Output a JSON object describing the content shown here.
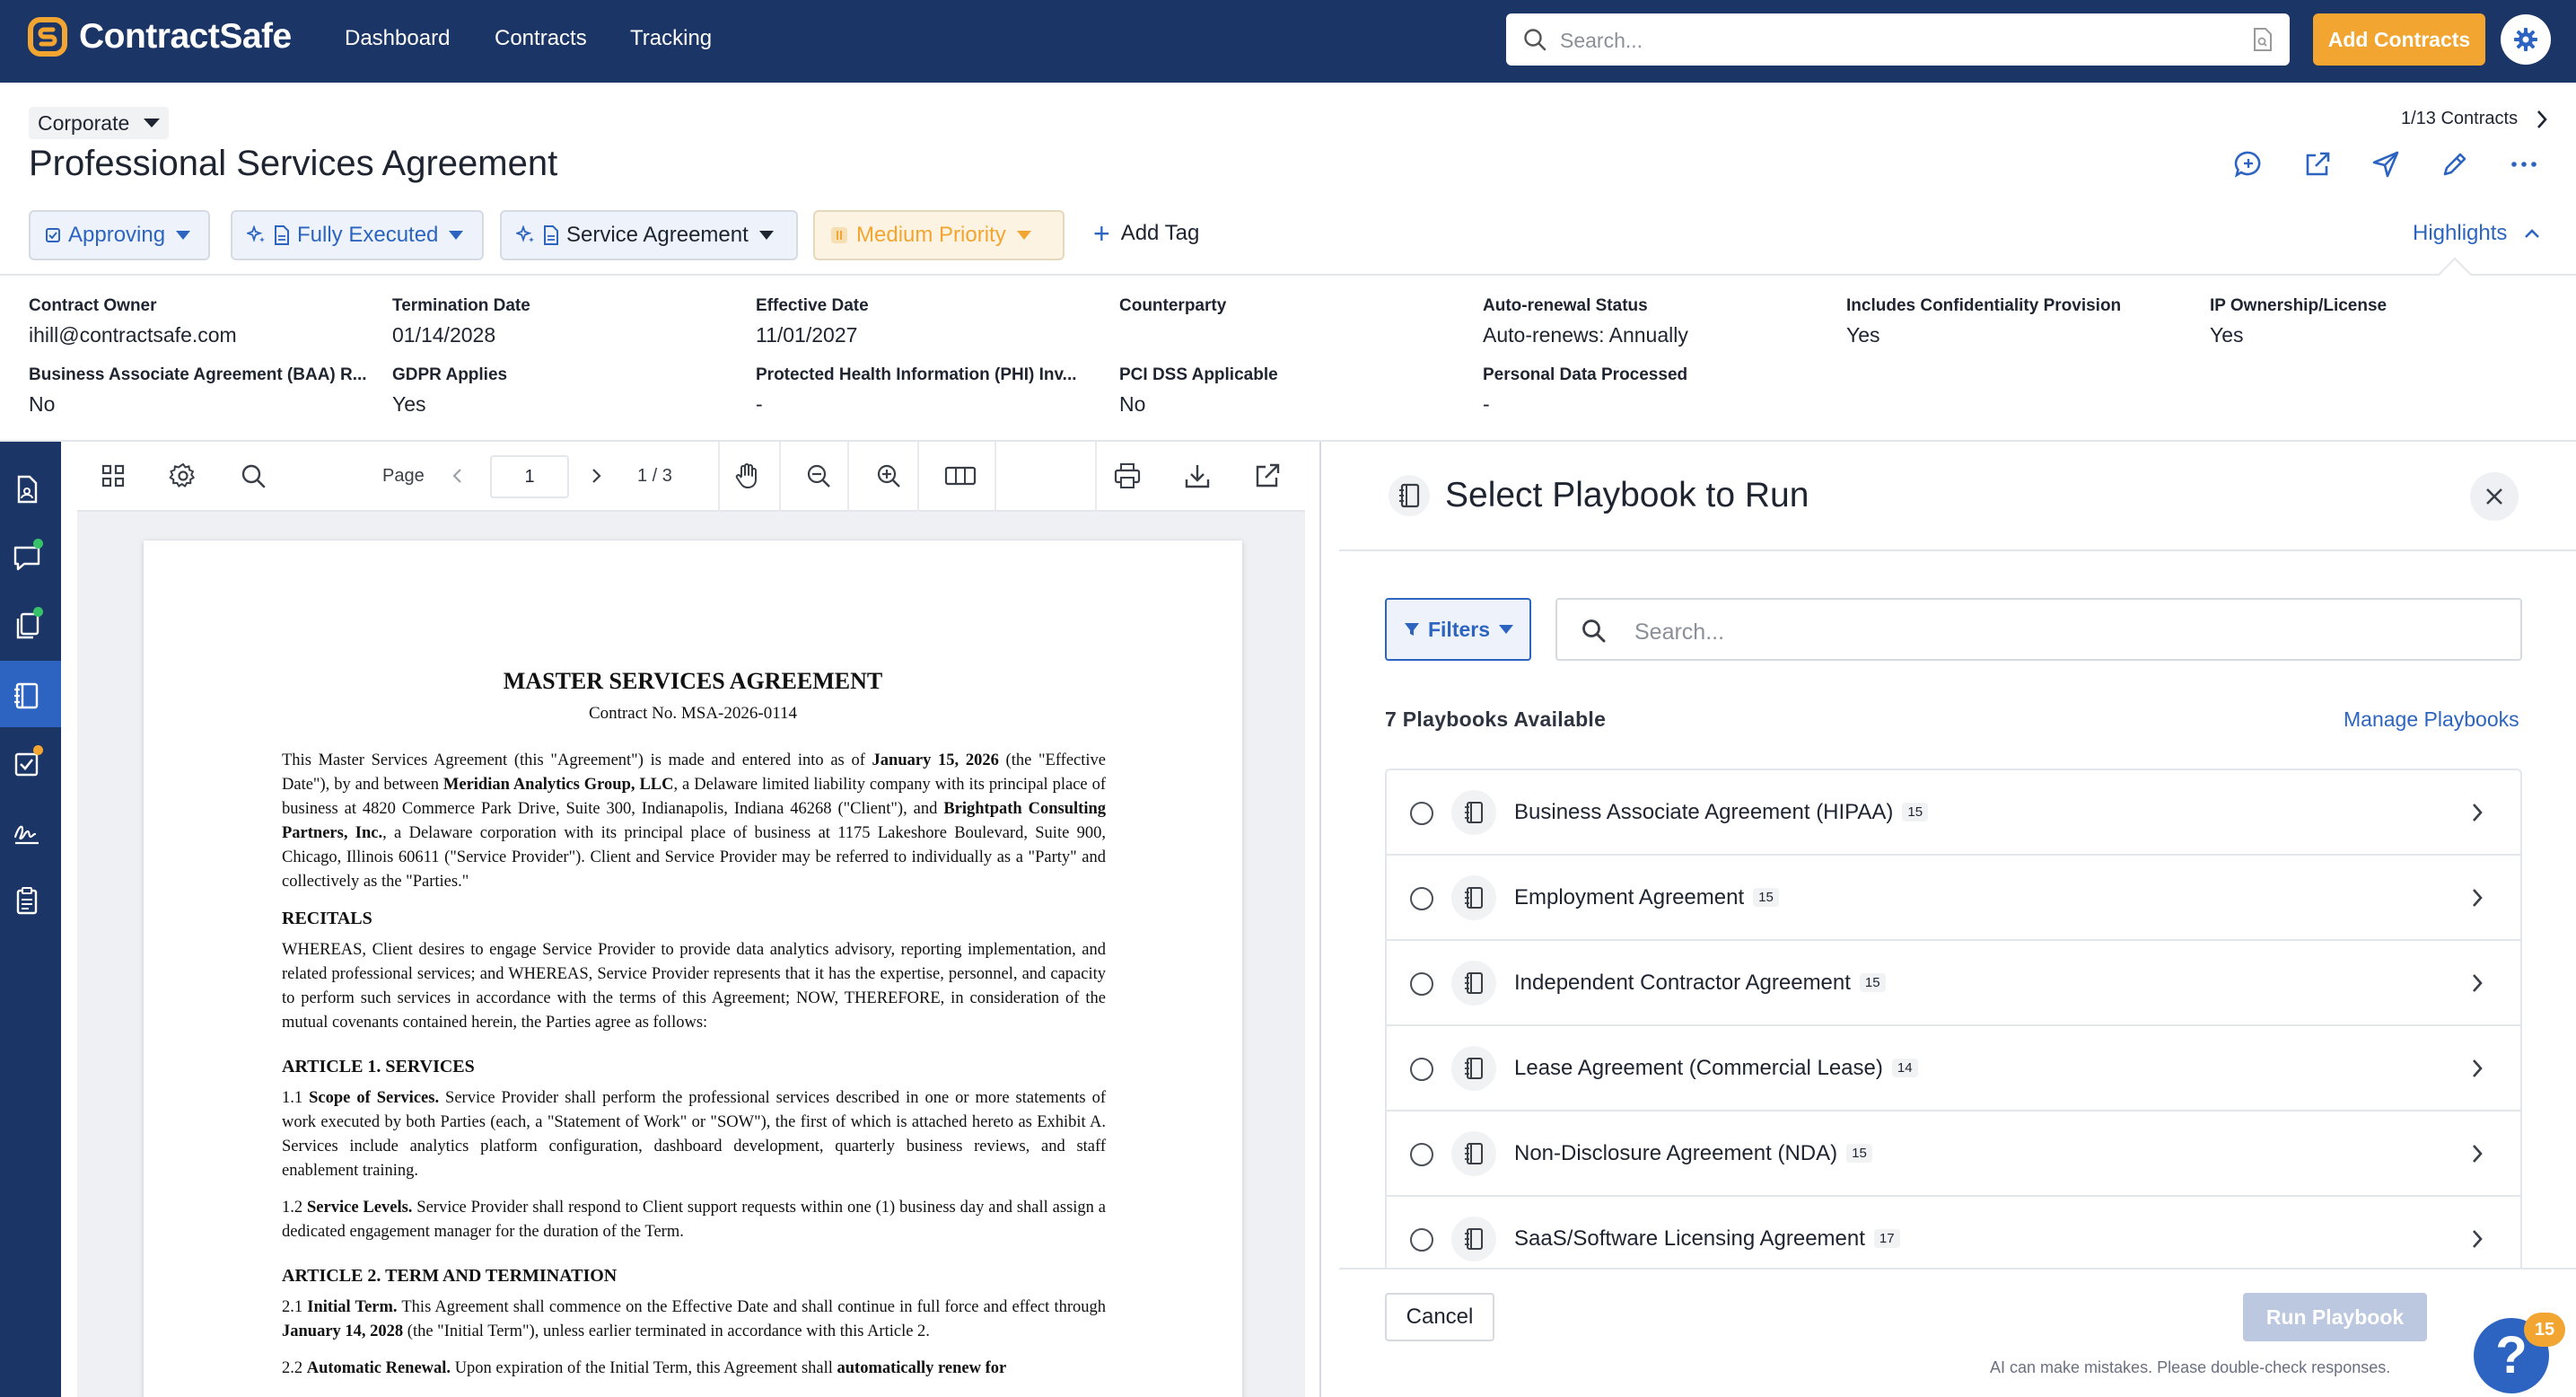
{
  "app": {
    "brand": "ContractSafe",
    "nav": [
      "Dashboard",
      "Contracts",
      "Tracking"
    ],
    "search_placeholder": "Search...",
    "add_contracts": "Add Contracts",
    "colors": {
      "navy": "#1b3566",
      "accent": "#f2a530",
      "link": "#2c64c0"
    }
  },
  "header": {
    "folder": "Corporate",
    "title": "Professional Services Agreement",
    "contract_count": "1/13 Contracts",
    "actions": [
      "comment-icon",
      "external-link-icon",
      "send-icon",
      "edit-icon",
      "more-icon"
    ]
  },
  "pills": {
    "status": "Approving",
    "execution": "Fully Executed",
    "type": "Service Agreement",
    "priority": "Medium Priority",
    "add_tag": "Add Tag",
    "highlights": "Highlights"
  },
  "metadata": [
    {
      "label": "Contract Owner",
      "value": "ihill@contractsafe.com"
    },
    {
      "label": "Termination Date",
      "value": "01/14/2028"
    },
    {
      "label": "Effective Date",
      "value": "11/01/2027"
    },
    {
      "label": "Counterparty",
      "value": ""
    },
    {
      "label": "Auto-renewal Status",
      "value": "Auto-renews: Annually"
    },
    {
      "label": "Includes Confidentiality Provision",
      "value": "Yes"
    },
    {
      "label": "IP Ownership/License",
      "value": "Yes"
    },
    {
      "label": "Business Associate Agreement (BAA) R...",
      "value": "No"
    },
    {
      "label": "GDPR Applies",
      "value": "Yes"
    },
    {
      "label": "Protected Health Information (PHI) Inv...",
      "value": "-"
    },
    {
      "label": "PCI DSS Applicable",
      "value": "No"
    },
    {
      "label": "Personal Data Processed",
      "value": "-"
    }
  ],
  "viewer": {
    "page_label": "Page",
    "page_value": "1",
    "page_total": "1 / 3"
  },
  "document": {
    "title": "MASTER SERVICES AGREEMENT",
    "subtitle": "Contract No. MSA-2026-0114",
    "intro_1": "This Master Services Agreement (this \"Agreement\") is made and entered into as of ",
    "intro_date": "January 15, 2026",
    "intro_2": " (the \"Effective Date\"), by and between ",
    "party_1": "Meridian Analytics Group, LLC",
    "intro_3": ", a Delaware limited liability company with its principal place of business at 4820 Commerce Park Drive, Suite 300, Indianapolis, Indiana 46268 (\"Client\"), and ",
    "party_2": "Brightpath Consulting Partners, Inc.",
    "intro_4": ", a Delaware corporation with its principal place of business at 1175 Lakeshore Boulevard, Suite 900, Chicago, Illinois 60611 (\"Service Provider\"). Client and Service Provider may be referred to individually as a \"Party\" and collectively as the \"Parties.\"",
    "recitals_h": "RECITALS",
    "recitals": "WHEREAS, Client desires to engage Service Provider to provide data analytics advisory, reporting implementation, and related professional services; and WHEREAS, Service Provider represents that it has the expertise, personnel, and capacity to perform such services in accordance with the terms of this Agreement; NOW, THEREFORE, in consideration of the mutual covenants contained herein, the Parties agree as follows:",
    "art1_h": "ARTICLE 1. SERVICES",
    "s11_num": "1.1 ",
    "s11_title": "Scope of Services.",
    "s11_text": " Service Provider shall perform the professional services described in one or more statements of work executed by both Parties (each, a \"Statement of Work\" or \"SOW\"), the first of which is attached hereto as Exhibit A. Services include analytics platform configuration, dashboard development, quarterly business reviews, and staff enablement training.",
    "s12_num": "1.2 ",
    "s12_title": "Service Levels.",
    "s12_text": " Service Provider shall respond to Client support requests within one (1) business day and shall assign a dedicated engagement manager for the duration of the Term.",
    "art2_h": "ARTICLE 2. TERM AND TERMINATION",
    "s21_num": "2.1 ",
    "s21_title": "Initial Term.",
    "s21_text_1": " This Agreement shall commence on the Effective Date and shall continue in full force and effect through ",
    "s21_date": "January 14, 2028",
    "s21_text_2": " (the \"Initial Term\"), unless earlier terminated in accordance with this Article 2.",
    "s22_num": "2.2 ",
    "s22_title": "Automatic Renewal.",
    "s22_text_1": " Upon expiration of the Initial Term, this Agreement shall ",
    "s22_bold": "automatically renew for"
  },
  "playbook_panel": {
    "title": "Select Playbook to Run",
    "filters": "Filters",
    "search_placeholder": "Search...",
    "count_label": "7 Playbooks Available",
    "manage_link": "Manage Playbooks",
    "items": [
      {
        "name": "Business Associate Agreement (HIPAA)",
        "count": "15"
      },
      {
        "name": "Employment Agreement",
        "count": "15"
      },
      {
        "name": "Independent Contractor Agreement",
        "count": "15"
      },
      {
        "name": "Lease Agreement (Commercial Lease)",
        "count": "14"
      },
      {
        "name": "Non-Disclosure Agreement (NDA)",
        "count": "15"
      },
      {
        "name": "SaaS/Software Licensing Agreement",
        "count": "17"
      }
    ],
    "cancel": "Cancel",
    "run": "Run Playbook",
    "disclaimer": "AI can make mistakes. Please double-check responses."
  },
  "help": {
    "icon": "?",
    "badge": "15"
  }
}
